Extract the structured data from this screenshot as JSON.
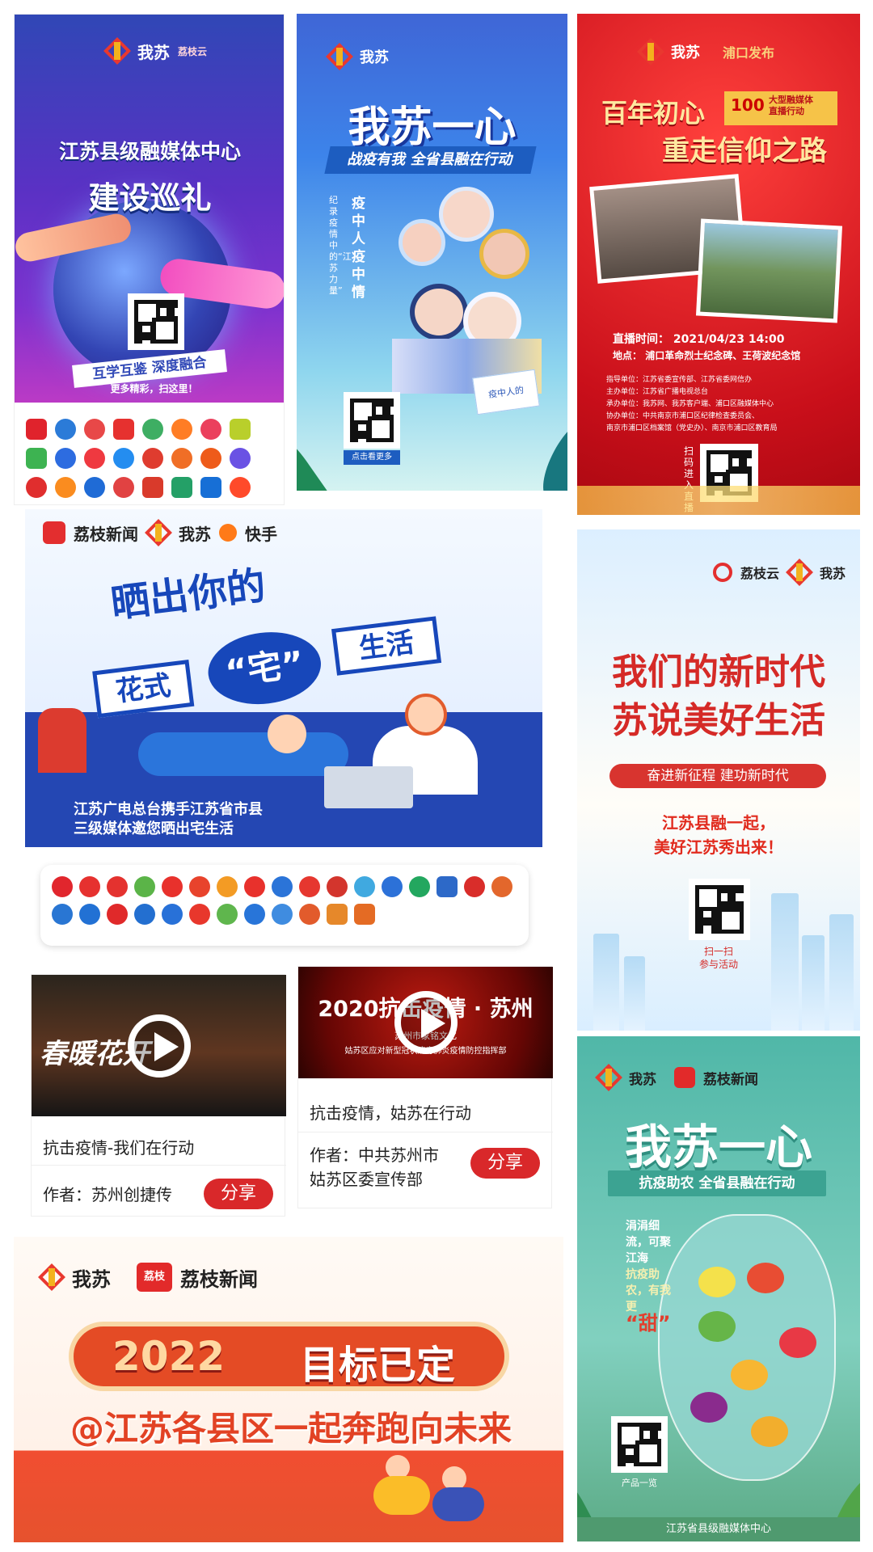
{
  "panels": {
    "tour": {
      "logo_text": "我苏",
      "logo_subtext": "荔枝云",
      "title_line1": "江苏县级融媒体中心",
      "title_line2": "建设巡礼",
      "banner": "互学互鉴 深度融合",
      "more": "更多精彩，扫这里！",
      "logo_labels": [
        "城市融媒",
        "融媒中心",
        "智慧城",
        "融媒",
        "今日海门",
        "南通发布",
        "无锡",
        "美丽常熟",
        "建湖发布",
        "智慧如东",
        "今日淮安",
        "融媒体",
        "掌上东台",
        "灌南发布",
        "宿迁发布",
        "射阳"
      ]
    },
    "epidemic": {
      "logo_text": "我苏",
      "title": "我苏一心",
      "subtitle": "战疫有我 全省县融在行动",
      "vertical_title": "疫中人 疫中情",
      "vertical_subtitle": "纪录疫情中的“江苏力量”",
      "qr_caption": "点击看更多",
      "book_text": "疫中人的"
    },
    "faith": {
      "logo_text": "我苏",
      "partner_text": "浦口发布",
      "title_line1": "百年初心",
      "title_line2": "重走信仰之路",
      "badge_line1": "大型融媒体",
      "badge_line2": "直播行动",
      "badge_number": "100",
      "time_label": "直播时间：",
      "time_value": "2021/04/23  14:00",
      "place_label": "地点：",
      "place_value": "浦口革命烈士纪念碑、王荷波纪念馆",
      "details": [
        "指导单位：江苏省委宣传部、江苏省委网信办",
        "主办单位：江苏省广播电视总台",
        "承办单位：我苏网、我苏客户端、浦口区融媒体中心",
        "协办单位：中共南京市浦口区纪律检查委员会、",
        "南京市浦口区档案馆（党史办）、南京市浦口区教育局"
      ],
      "scan_text": "扫码进入直播"
    },
    "home": {
      "logos": [
        "荔枝新闻",
        "我苏",
        "快手"
      ],
      "title_top": "晒出你的",
      "title_main": [
        "花式",
        "“宅”",
        "生活"
      ],
      "caption_line1": "江苏广电总台携手江苏省市县",
      "caption_line2": "三级媒体邀您晒出宅生活",
      "strip_labels": [
        "江苏发布",
        "新闻",
        "融媒",
        "南京发布",
        "江南",
        "掌上",
        "扬州",
        "通州",
        "智慧",
        "常州",
        "南京",
        "江宁发布",
        "宿迁",
        "吴江",
        "荔枝",
        "昆山",
        "连云港",
        "宜兴",
        "扬帆",
        "江阴",
        "南通",
        "镇江",
        "泰州",
        "淮安",
        "盐城",
        "徐州"
      ]
    },
    "new_era": {
      "logos": [
        "荔枝云",
        "我苏"
      ],
      "title_line1": "我们的新时代",
      "title_line2": "苏说美好生活",
      "ribbon": "奋进新征程  建功新时代",
      "slogan_line1": "江苏县融一起，",
      "slogan_line2": "美好江苏秀出来！",
      "qr_caption_1": "扫一扫",
      "qr_caption_2": "参与活动"
    },
    "videos": [
      {
        "overlay": "春暖花开",
        "title": "抗击疫情-我们在行动",
        "author": "作者：苏州创捷传",
        "share": "分享"
      },
      {
        "overlay": "2020抗击疫情 · 苏州",
        "overlay_sub": "苏州市家铭文化",
        "overlay_sub2": "姑苏区应对新型冠状病毒肺炎疫情防控指挥部",
        "title": "抗击疫情，姑苏在行动",
        "author_line1": "作者：中共苏州市",
        "author_line2": "姑苏区委宣传部",
        "share": "分享"
      }
    ],
    "goal": {
      "logos": [
        "我苏",
        "荔枝",
        "荔枝新闻"
      ],
      "title_year": "2022",
      "title_text": "目标已定",
      "subtitle": "@江苏各县区一起奔跑向未来"
    },
    "farm": {
      "logos": [
        "我苏",
        "荔枝新闻"
      ],
      "title": "我苏一心",
      "subtitle": "抗疫助农  全省县融在行动",
      "poem": [
        "涓涓细流，可聚江海",
        "抗疫助农，有我更",
        "“甜”"
      ],
      "qr_caption": "产品一览",
      "footer": "江苏省县级融媒体中心"
    }
  },
  "colors": {
    "red": "#d9282a",
    "blue": "#2249b6",
    "green": "#5bbeb0"
  }
}
